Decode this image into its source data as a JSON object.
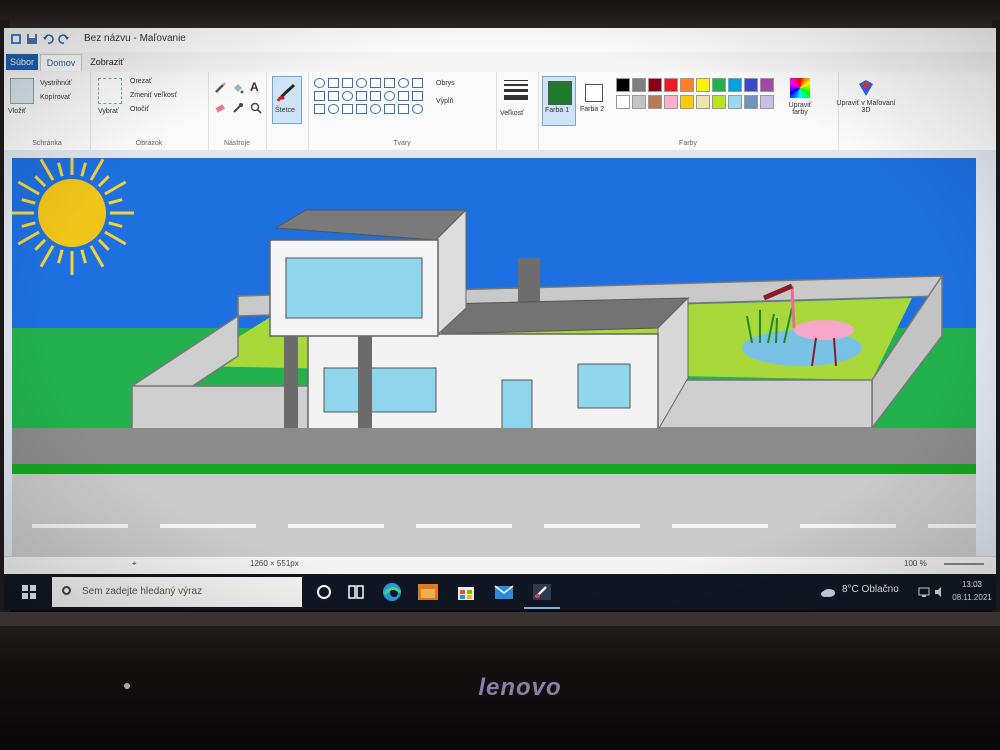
{
  "window": {
    "title": "Bez názvu - Maľovanie"
  },
  "tabs": [
    {
      "label": "Súbor"
    },
    {
      "label": "Domov"
    },
    {
      "label": "Zobraziť"
    }
  ],
  "ribbon": {
    "clipboard": {
      "paste": "Vložiť",
      "cut": "Vystrihnúť",
      "copy": "Kopírovať",
      "group": "Schránka"
    },
    "image": {
      "select": "Vybrať",
      "crop": "Orezať",
      "resize": "Zmeniť veľkosť",
      "rotate": "Otočiť",
      "group": "Obrázok"
    },
    "tools": {
      "group": "Nástroje"
    },
    "brushes": {
      "label": "Štetce"
    },
    "shapes": {
      "outline": "Obrys",
      "fill": "Výplň",
      "group": "Tvary"
    },
    "size": {
      "label": "Veľkosť"
    },
    "colors": {
      "color1": "Farba 1",
      "color2": "Farba 2",
      "edit": "Upraviť farby",
      "paint3d": "Upraviť v Maľovaní 3D",
      "group": "Farby",
      "active_color1": "#1e7a2c",
      "active_color2": "#ffffff",
      "palette_row1": [
        "#000000",
        "#7f7f7f",
        "#880015",
        "#ed1c24",
        "#ff7f27",
        "#fff200",
        "#22b14c",
        "#00a2e8",
        "#3f48cc",
        "#a349a4"
      ],
      "palette_row2": [
        "#ffffff",
        "#c3c3c3",
        "#b97a57",
        "#ffaec9",
        "#ffc90e",
        "#efe4b0",
        "#b5e61d",
        "#99d9ea",
        "#7092be",
        "#c8bfe7"
      ]
    }
  },
  "status": {
    "dimensions": "1260 × 551px",
    "zoom": "100 %"
  },
  "taskbar": {
    "search_placeholder": "Sem zadejte hledaný výraz",
    "weather": "8°C  Oblačno",
    "time": "13:03",
    "date": "08.11.2021"
  },
  "icons": [
    "windows-start-icon",
    "search-icon",
    "cortana-icon",
    "task-view-icon",
    "edge-icon",
    "explorer-icon",
    "store-icon",
    "mail-icon",
    "paint-icon",
    "cloud-icon",
    "network-icon",
    "volume-icon"
  ],
  "monitor": {
    "brand": "lenovo"
  }
}
